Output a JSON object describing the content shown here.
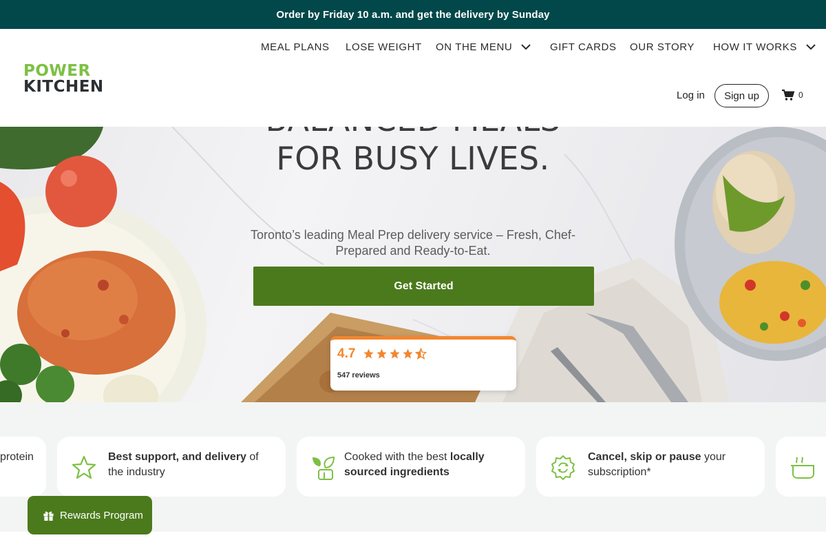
{
  "announcement": {
    "text": "Order by Friday 10 a.m. and get the delivery by Sunday"
  },
  "brand": {
    "line1": "POWER",
    "line2": "KITCHEN",
    "green": "#7cc043",
    "dark": "#2d3033"
  },
  "nav": {
    "meal_plans": "MEAL PLANS",
    "lose_weight": "LOSE WEIGHT",
    "on_the_menu": "ON THE MENU",
    "gift_cards": "GIFT CARDS",
    "our_story": "OUR STORY",
    "how_it_works": "HOW IT WORKS"
  },
  "auth": {
    "login": "Log in",
    "signup": "Sign up",
    "cart_count": "0"
  },
  "hero": {
    "title_line1": "BALANCED MEALS",
    "title_line2": "FOR BUSY LIVES.",
    "subtitle": "Toronto’s leading Meal Prep delivery service – Fresh, Chef-Prepared and Ready-to-Eat.",
    "cta": "Get Started"
  },
  "review_badge": {
    "rating": "4.7",
    "reviews": "547 reviews",
    "stars": 4.5,
    "accent": "#f2862f"
  },
  "features": [
    {
      "pre": "",
      "bold": "",
      "post": "protein",
      "icon": "protein-icon"
    },
    {
      "pre": "",
      "bold": "Best support, and delivery",
      "post": " of the industry",
      "icon": "star-icon"
    },
    {
      "pre": "Cooked with the best ",
      "bold": "locally sourced ingredients",
      "post": "",
      "icon": "leaf-icon"
    },
    {
      "pre": "",
      "bold": "Cancel, skip or pause",
      "post": " your subscription*",
      "icon": "cycle-badge-icon"
    },
    {
      "pre": "",
      "bold": "",
      "post": "",
      "icon": "pot-icon"
    }
  ],
  "rewards": {
    "label": "Rewards Program"
  },
  "colors": {
    "header_bg": "#02484a",
    "primary": "#4b7a1c",
    "strip_bg": "#f3f5f4"
  }
}
